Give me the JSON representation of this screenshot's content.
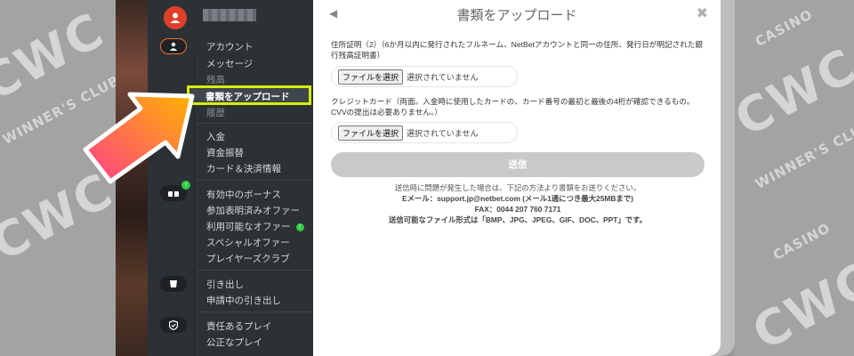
{
  "watermark": {
    "brand": "CWC",
    "casino": "CASINO",
    "club": "WINNER'S CLUB"
  },
  "sidebar": {
    "menu_groups": [
      [
        "アカウント",
        "メッセージ",
        "残高",
        "書類をアップロード",
        "履歴"
      ],
      [
        "入金",
        "資金振替",
        "カード＆決済情報"
      ],
      [
        "有効中のボーナス",
        "参加表明済みオファー",
        "利用可能なオファー",
        "スペシャルオファー",
        "プレイヤーズクラブ"
      ],
      [
        "引き出し",
        "申請中の引き出し"
      ],
      [
        "責任あるプレイ",
        "公正なプレイ"
      ]
    ],
    "badge_bonus": "!",
    "badge_offer": "!"
  },
  "modal": {
    "back_icon": "◀",
    "title": "書類をアップロード",
    "close_icon": "✖",
    "section1_label": "住所証明（2）（6か月以内に発行されたフルネーム、NetBetアカウントと同一の住所、発行日が明記された銀行残高証明書）",
    "section2_label": "クレジットカード（両面。入金時に使用したカードの、カード番号の最初と最後の4桁が確認できるもの。CVVの提出は必要ありません。）",
    "file_button": "ファイルを選択",
    "file_status": "選択されていません",
    "submit_label": "送信",
    "info_line1": "送信時に問題が発生した場合は、下記の方法より書類をお送りください。",
    "info_line2": "Eメール：support.jp@netbet.com (メール1通につき最大25MBまで)",
    "info_line3": "FAX：0044 207 760 7171",
    "info_line4": "送信可能なファイル形式は「BMP、JPG、JPEG、GIF、DOC、PPT」です。"
  },
  "colors": {
    "sidebar_bg": "#2c3136",
    "highlight_border": "#d4f000",
    "arrow_start": "#ff3e8a",
    "arrow_end": "#ffb300",
    "avatar": "#e0402a",
    "badge": "#2ecc40"
  }
}
